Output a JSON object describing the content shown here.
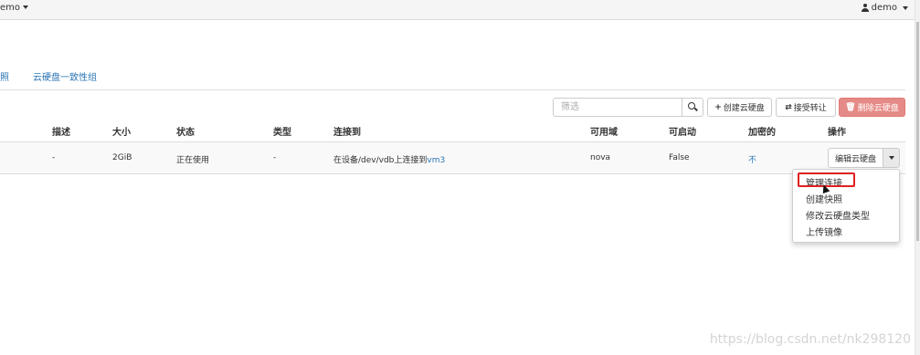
{
  "topbar": {
    "project_label": "emo",
    "user_label": "demo"
  },
  "tabs": [
    {
      "label": "照"
    },
    {
      "label": "云硬盘一致性组"
    }
  ],
  "actions": {
    "filter_placeholder": "筛选",
    "create_label": "创建云硬盘",
    "accept_transfer_label": "接受转让",
    "delete_label": "删除云硬盘"
  },
  "table": {
    "headers": {
      "description": "描述",
      "size": "大小",
      "status": "状态",
      "type": "类型",
      "attached_to": "连接到",
      "availability_zone": "可用域",
      "bootable": "可启动",
      "encrypted": "加密的",
      "actions": "操作"
    },
    "rows": [
      {
        "description": "-",
        "size": "2GiB",
        "status": "正在使用",
        "type": "-",
        "attached_prefix": "在设备/dev/vdb上连接到",
        "attached_link": "vm3",
        "availability_zone": "nova",
        "bootable": "False",
        "encrypted": "不",
        "action_button": "编辑云硬盘"
      }
    ]
  },
  "dropdown": {
    "items": [
      "管理连接",
      "创建快照",
      "修改云硬盘类型",
      "上传镜像"
    ],
    "highlighted_item": "管理连接"
  },
  "watermark": "https://blog.csdn.net/nk298120",
  "colors": {
    "link": "#2a75b5",
    "danger": "#e58a86",
    "highlight": "#e01f1f"
  }
}
